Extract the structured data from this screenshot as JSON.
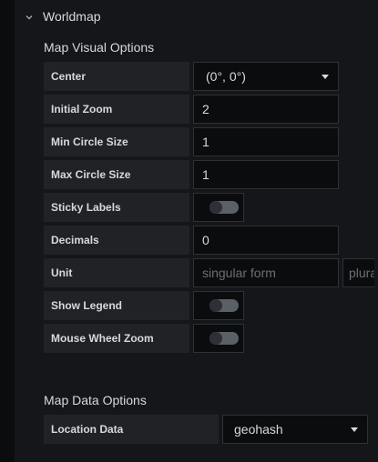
{
  "section": {
    "title": "Worldmap",
    "icon": "chevron-down-icon"
  },
  "visual_options": {
    "title": "Map Visual Options",
    "center": {
      "label": "Center",
      "value": "(0°, 0°)"
    },
    "initial_zoom": {
      "label": "Initial Zoom",
      "value": "2"
    },
    "min_circle_size": {
      "label": "Min Circle Size",
      "value": "1"
    },
    "max_circle_size": {
      "label": "Max Circle Size",
      "value": "1"
    },
    "sticky_labels": {
      "label": "Sticky Labels",
      "on": false
    },
    "decimals": {
      "label": "Decimals",
      "value": "0"
    },
    "unit": {
      "label": "Unit",
      "singular_placeholder": "singular form",
      "plural_placeholder": "plural form"
    },
    "show_legend": {
      "label": "Show Legend",
      "on": false
    },
    "mouse_wheel_zoom": {
      "label": "Mouse Wheel Zoom",
      "on": false
    }
  },
  "data_options": {
    "title": "Map Data Options",
    "location_data": {
      "label": "Location Data",
      "value": "geohash"
    }
  }
}
